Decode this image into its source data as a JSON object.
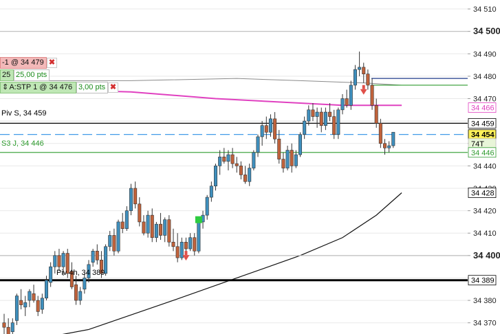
{
  "chart_data": {
    "type": "candlestick",
    "instrument_price_axis": {
      "ticks": [
        34370,
        34380,
        34390,
        34400,
        34410,
        34420,
        34430,
        34440,
        34450,
        34460,
        34470,
        34480,
        34490,
        34500,
        34510
      ],
      "tick_labels": [
        "34 370",
        "34 380",
        "34 390",
        "34 400",
        "34 410",
        "34 420",
        "34 430",
        "34 440",
        "34 450",
        "34 460",
        "34 470",
        "34 480",
        "34 490",
        "34 500",
        "34 510"
      ],
      "bold_ticks": [
        34400,
        34500
      ],
      "ylim": [
        34365,
        34514
      ]
    },
    "candles": [
      [
        34370,
        34374,
        34364,
        34368
      ],
      [
        34368,
        34372,
        34362,
        34364
      ],
      [
        34366,
        34372,
        34363,
        34370
      ],
      [
        34371,
        34383,
        34369,
        34382
      ],
      [
        34380,
        34385,
        34376,
        34378
      ],
      [
        34377,
        34382,
        34373,
        34379
      ],
      [
        34380,
        34385,
        34377,
        34384
      ],
      [
        34383,
        34387,
        34379,
        34380
      ],
      [
        34380,
        34382,
        34373,
        34375
      ],
      [
        34376,
        34383,
        34374,
        34381
      ],
      [
        34381,
        34391,
        34380,
        34389
      ],
      [
        34388,
        34397,
        34386,
        34395
      ],
      [
        34395,
        34402,
        34392,
        34400
      ],
      [
        34400,
        34403,
        34393,
        34395
      ],
      [
        34395,
        34402,
        34391,
        34401
      ],
      [
        34401,
        34403,
        34390,
        34392
      ],
      [
        34393,
        34397,
        34385,
        34386
      ],
      [
        34387,
        34391,
        34378,
        34380
      ],
      [
        34380,
        34386,
        34378,
        34384
      ],
      [
        34385,
        34392,
        34383,
        34390
      ],
      [
        34390,
        34398,
        34388,
        34396
      ],
      [
        34397,
        34403,
        34395,
        34402
      ],
      [
        34402,
        34405,
        34396,
        34398
      ],
      [
        34398,
        34402,
        34390,
        34392
      ],
      [
        34392,
        34405,
        34391,
        34404
      ],
      [
        34404,
        34411,
        34402,
        34409
      ],
      [
        34409,
        34412,
        34400,
        34402
      ],
      [
        34402,
        34416,
        34401,
        34415
      ],
      [
        34415,
        34419,
        34410,
        34412
      ],
      [
        34412,
        34422,
        34411,
        34420
      ],
      [
        34420,
        34432,
        34418,
        34430
      ],
      [
        34430,
        34433,
        34421,
        34423
      ],
      [
        34423,
        34426,
        34413,
        34415
      ],
      [
        34415,
        34418,
        34409,
        34410
      ],
      [
        34410,
        34420,
        34408,
        34418
      ],
      [
        34418,
        34421,
        34406,
        34408
      ],
      [
        34408,
        34415,
        34406,
        34414
      ],
      [
        34414,
        34419,
        34407,
        34409
      ],
      [
        34409,
        34417,
        34406,
        34416
      ],
      [
        34416,
        34418,
        34404,
        34406
      ],
      [
        34406,
        34412,
        34402,
        34404
      ],
      [
        34404,
        34410,
        34397,
        34399
      ],
      [
        34399,
        34408,
        34398,
        34406
      ],
      [
        34406,
        34408,
        34401,
        34403
      ],
      [
        34403,
        34410,
        34402,
        34408
      ],
      [
        34408,
        34410,
        34400,
        34402
      ],
      [
        34402,
        34417,
        34401,
        34415
      ],
      [
        34415,
        34420,
        34412,
        34418
      ],
      [
        34418,
        34427,
        34416,
        34426
      ],
      [
        34426,
        34433,
        34424,
        34431
      ],
      [
        34431,
        34441,
        34429,
        34440
      ],
      [
        34440,
        34447,
        34436,
        34444
      ],
      [
        34444,
        34448,
        34441,
        34442
      ],
      [
        34442,
        34447,
        34438,
        34445
      ],
      [
        34445,
        34448,
        34439,
        34441
      ],
      [
        34441,
        34444,
        34437,
        34440
      ],
      [
        34440,
        34442,
        34434,
        34436
      ],
      [
        34436,
        34440,
        34432,
        34433
      ],
      [
        34433,
        34441,
        34431,
        34439
      ],
      [
        34439,
        34447,
        34438,
        34446
      ],
      [
        34446,
        34454,
        34444,
        34453
      ],
      [
        34453,
        34460,
        34449,
        34458
      ],
      [
        34458,
        34462,
        34452,
        34455
      ],
      [
        34455,
        34463,
        34453,
        34461
      ],
      [
        34461,
        34464,
        34450,
        34452
      ],
      [
        34452,
        34456,
        34441,
        34443
      ],
      [
        34443,
        34446,
        34437,
        34439
      ],
      [
        34439,
        34449,
        34438,
        34447
      ],
      [
        34447,
        34450,
        34437,
        34440
      ],
      [
        34440,
        34447,
        34439,
        34445
      ],
      [
        34445,
        34455,
        34444,
        34454
      ],
      [
        34454,
        34462,
        34452,
        34460
      ],
      [
        34460,
        34467,
        34458,
        34465
      ],
      [
        34465,
        34468,
        34460,
        34462
      ],
      [
        34462,
        34466,
        34457,
        34464
      ],
      [
        34464,
        34466,
        34455,
        34458
      ],
      [
        34458,
        34466,
        34456,
        34464
      ],
      [
        34464,
        34468,
        34460,
        34462
      ],
      [
        34462,
        34465,
        34452,
        34454
      ],
      [
        34454,
        34466,
        34452,
        34465
      ],
      [
        34465,
        34472,
        34463,
        34470
      ],
      [
        34470,
        34474,
        34466,
        34467
      ],
      [
        34467,
        34478,
        34465,
        34476
      ],
      [
        34476,
        34485,
        34474,
        34483
      ],
      [
        34483,
        34491,
        34480,
        34484
      ],
      [
        34484,
        34486,
        34477,
        34481
      ],
      [
        34481,
        34483,
        34474,
        34476
      ],
      [
        34476,
        34479,
        34465,
        34467
      ],
      [
        34467,
        34470,
        34457,
        34459
      ],
      [
        34459,
        34461,
        34448,
        34450
      ],
      [
        34450,
        34452,
        34445,
        34448
      ],
      [
        34448,
        34451,
        34446,
        34449
      ],
      [
        34449,
        34455,
        34448,
        34455
      ]
    ],
    "lines": {
      "sma_black": [
        [
          0,
          34360
        ],
        [
          20,
          34367
        ],
        [
          40,
          34380
        ],
        [
          55,
          34390
        ],
        [
          70,
          34400
        ],
        [
          80,
          34408
        ],
        [
          88,
          34418
        ],
        [
          94,
          34428
        ]
      ],
      "pink_ma": [
        [
          10,
          34474
        ],
        [
          30,
          34473
        ],
        [
          50,
          34470
        ],
        [
          70,
          34468
        ],
        [
          80,
          34467
        ],
        [
          94,
          34467
        ]
      ],
      "gray_curve": [
        [
          0,
          34478
        ],
        [
          30,
          34478
        ],
        [
          55,
          34479
        ],
        [
          70,
          34478
        ],
        [
          85,
          34477
        ],
        [
          94,
          34476
        ]
      ]
    },
    "levels": [
      {
        "price": 34459,
        "label": "Piv S, 34 459",
        "color": "#000000"
      },
      {
        "price": 34446,
        "label": "S3 J, 34 446",
        "color": "#2e9b2e"
      },
      {
        "price": 34389,
        "label": "Piv 4h, 34 389",
        "color": "#000000"
      },
      {
        "price": 34500,
        "color": "#bdbdbd"
      },
      {
        "price": 34400,
        "color": "#bdbdbd"
      },
      {
        "price": 34479,
        "color": "#1e3a8a"
      },
      {
        "price": 34476,
        "color": "#2e9b2e"
      },
      {
        "price": 34454,
        "color": "#2a8fe6",
        "dashed": true
      }
    ],
    "price_badges": [
      {
        "text": "34 466",
        "price": 34466,
        "bg": "#ffffff",
        "fg": "#e040c0",
        "border": "#e040c0"
      },
      {
        "text": "34 459",
        "price": 34459,
        "bg": "#ffffff",
        "fg": "#000000",
        "border": "#000000"
      },
      {
        "text": "34 454",
        "price": 34454,
        "bg": "#fff25a",
        "fg": "#000000",
        "border": "#000000"
      },
      {
        "text": "74T",
        "price": 34450,
        "bg": "#e8f5d8",
        "fg": "#000000",
        "border": "#bdbdbd"
      },
      {
        "text": "34 446",
        "price": 34446,
        "bg": "#ffffff",
        "fg": "#2e9b2e",
        "border": "#2e9b2e"
      },
      {
        "text": "34 428",
        "price": 34428,
        "bg": "#ffffff",
        "fg": "#000000",
        "border": "#000000"
      },
      {
        "text": "34 389",
        "price": 34389,
        "bg": "#ffffff",
        "fg": "#000000",
        "border": "#000000"
      }
    ],
    "markers": [
      {
        "type": "buy-square",
        "candle": 46,
        "price": 34416,
        "color": "#2ecc40"
      },
      {
        "type": "sell-arrow",
        "candle": 43,
        "price": 34399,
        "color": "#e0504a"
      },
      {
        "type": "sell-arrow",
        "candle": 85,
        "price": 34473,
        "color": "#e0504a"
      }
    ],
    "colors": {
      "up": "#3f8fbd",
      "down": "#c0623b",
      "grid": "#e8e8e8",
      "background": "#ffffff"
    }
  },
  "orders": {
    "sell_order": {
      "label": "-1 @ 34 479",
      "close": "✖"
    },
    "sell_row2": {
      "qty": "25",
      "pts": "25,00 pts"
    },
    "stop_order": {
      "label": "A:STP  1 @ 34 476",
      "pts": "3,00 pts",
      "close": "✖",
      "icon": "scroll-icon"
    }
  }
}
